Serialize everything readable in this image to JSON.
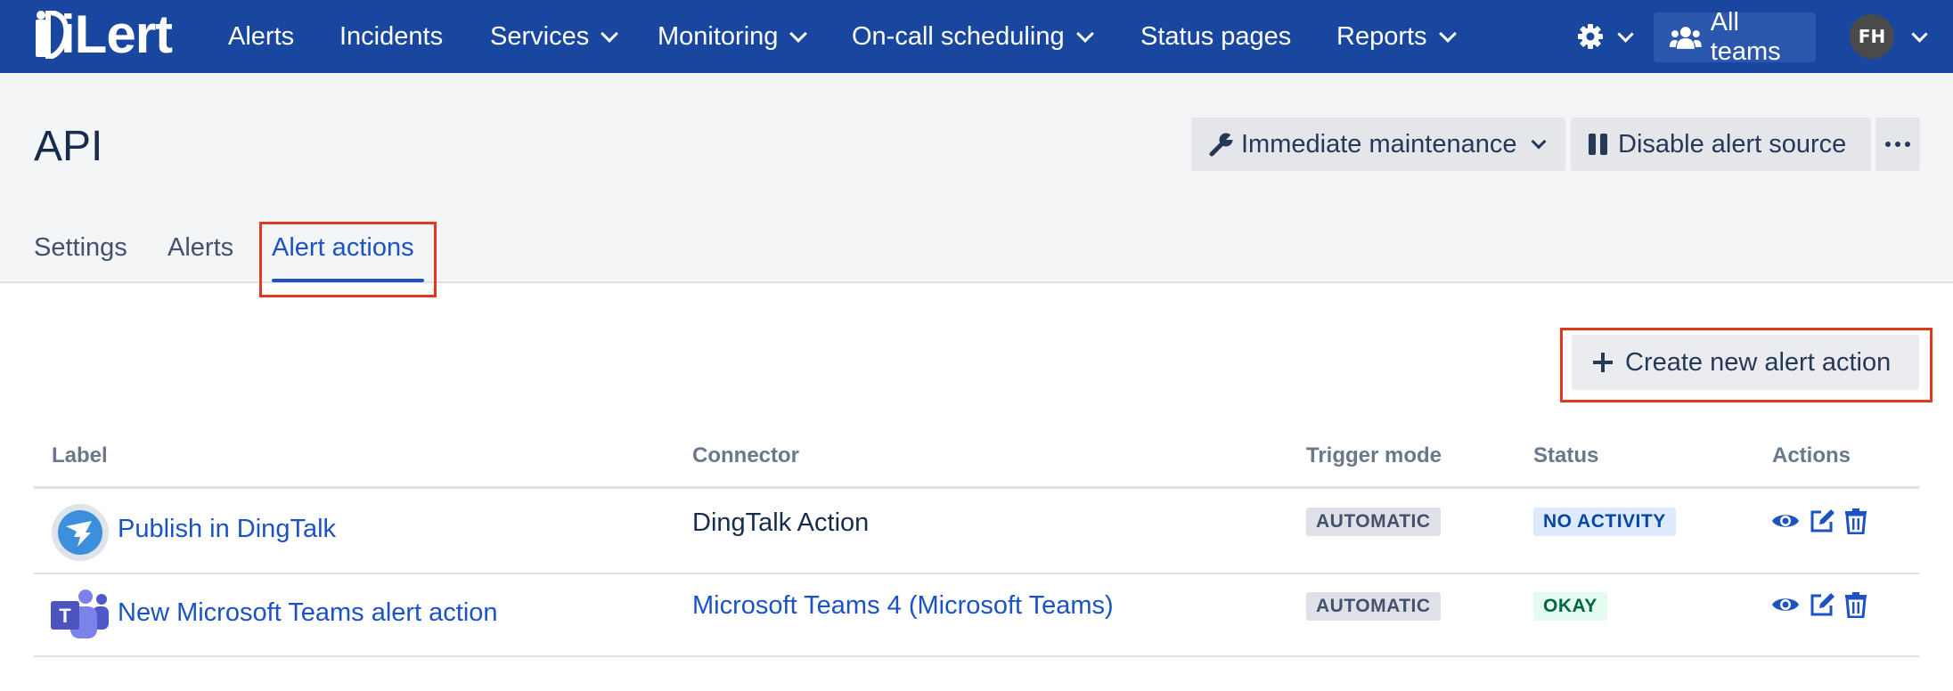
{
  "nav": {
    "logo_text": "iLert",
    "items": [
      {
        "label": "Alerts",
        "dropdown": false
      },
      {
        "label": "Incidents",
        "dropdown": false
      },
      {
        "label": "Services",
        "dropdown": true
      },
      {
        "label": "Monitoring",
        "dropdown": true
      },
      {
        "label": "On-call scheduling",
        "dropdown": true
      },
      {
        "label": "Status pages",
        "dropdown": false
      },
      {
        "label": "Reports",
        "dropdown": true
      }
    ],
    "settings_icon": "gear-icon",
    "teams_label": "All teams",
    "avatar_initials": "FH"
  },
  "header": {
    "title": "API",
    "maintenance_label": "Immediate maintenance",
    "disable_label": "Disable alert source"
  },
  "tabs": [
    {
      "label": "Settings",
      "active": false
    },
    {
      "label": "Alerts",
      "active": false
    },
    {
      "label": "Alert actions",
      "active": true
    }
  ],
  "content": {
    "create_label": "Create new alert action",
    "columns": [
      "Label",
      "Connector",
      "Trigger mode",
      "Status",
      "Actions"
    ],
    "rows": [
      {
        "label": "Publish in DingTalk",
        "icon": "dingtalk-icon",
        "connector": "DingTalk Action",
        "connector_is_link": false,
        "trigger_mode": "AUTOMATIC",
        "status": "NO ACTIVITY"
      },
      {
        "label": "New Microsoft Teams alert action",
        "icon": "microsoft-teams-icon",
        "connector": "Microsoft Teams 4 (Microsoft Teams)",
        "connector_is_link": true,
        "trigger_mode": "AUTOMATIC",
        "status": "OKAY"
      }
    ]
  },
  "colors": {
    "nav_bg": "#1947a0",
    "link": "#1b53c4",
    "highlight": "#e0391f",
    "header_bg": "#f4f5f7"
  }
}
